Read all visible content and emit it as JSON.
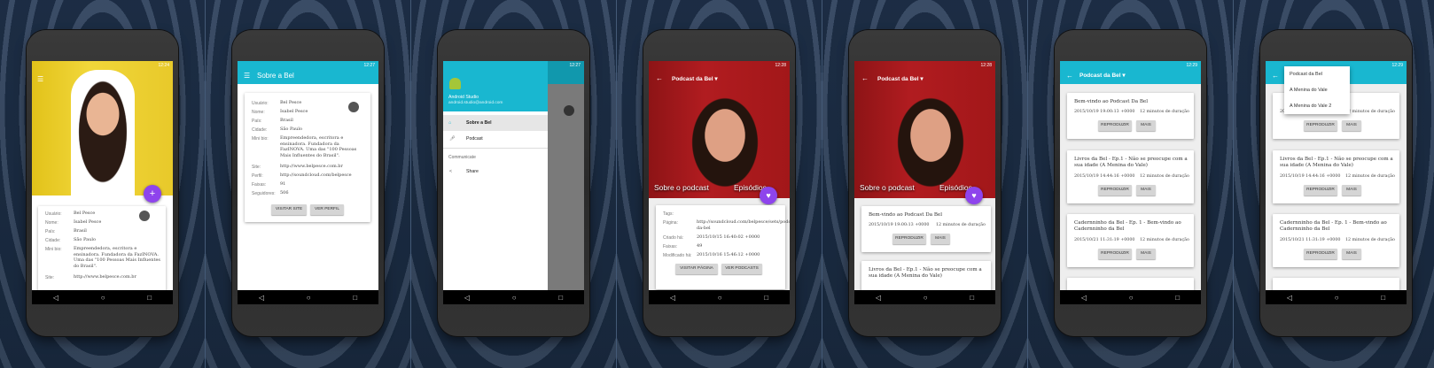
{
  "status": {
    "time1": "12:24",
    "time2": "12:27",
    "time3": "12:27",
    "time4": "12:28",
    "time5": "12:28",
    "time6": "12:29",
    "time7": "12:29"
  },
  "profile": {
    "labels": {
      "usuario": "Usuário:",
      "nome": "Nome:",
      "pais": "País:",
      "cidade": "Cidade:",
      "minibio": "Mini bio:",
      "site": "Site:",
      "perfil": "Perfil:",
      "faixas": "Faixas:",
      "seguidores": "Seguidores:"
    },
    "usuario": "Bel Pesce",
    "nome": "Isabel Pesce",
    "pais": "Brasil",
    "cidade": "São Paulo",
    "minibio": "Empreendedora, escritora e ensinadora. Fundadora da FazINOVA. Uma das \"100 Pessoas Mais Influentes do Brasil\".",
    "site": "http://www.belpesce.com.br",
    "perfil": "http://soundcloud.com/belpesce",
    "faixas": "91",
    "seguidores": "506",
    "btn_site": "VISITAR SITE",
    "btn_perfil": "VER PERFIL"
  },
  "about_title": "Sobre a Bel",
  "drawer": {
    "app_name": "Android Studio",
    "email": "android.studio@android.com",
    "item1": "Sobre a Bel",
    "item2": "Podcast",
    "section": "Communicate",
    "item3": "Share"
  },
  "podcast": {
    "title": "Podcast da Bel",
    "tab1": "Sobre o podcast",
    "tab2": "Episódios",
    "labels": {
      "tags": "Tags:",
      "pagina": "Página:",
      "criado": "Criado há:",
      "faixas": "Faixas:",
      "modificado": "Modificado há:"
    },
    "pagina": "http://soundcloud.com/belpesce/sets/podcast-da-bel",
    "criado": "2015/10/15 16:40:02 +0000",
    "faixas": "49",
    "modificado": "2015/10/16 15:46:12 +0000",
    "btn_pagina": "VISITAR PÁGINA",
    "btn_podcasts": "VER PODCASTS"
  },
  "episodes": [
    {
      "title": "Bem-vindo ao Podcast Da Bel",
      "date": "2015/10/19 19:00:13 +0000",
      "duration": "12 minutos de duração"
    },
    {
      "title": "Livros da Bel - Ep.1 - Não se preocupe com a sua idade (A Menina do Vale)",
      "date": "2015/10/19 14:44:16 +0000",
      "duration": "12 minutos de duração"
    },
    {
      "title": "Cadernninho da Bel - Ep. 1 - Bem-vindo ao Cadernninho da Bel",
      "date": "2015/10/21 11:31:19 +0000",
      "duration": "12 minutos de duração"
    }
  ],
  "ep_btn1": "REPRODUZIR",
  "ep_btn2": "MAIS",
  "menu": [
    "Podcast da Bel",
    "A Menina do Vale",
    "A Menina do Vale 2"
  ]
}
